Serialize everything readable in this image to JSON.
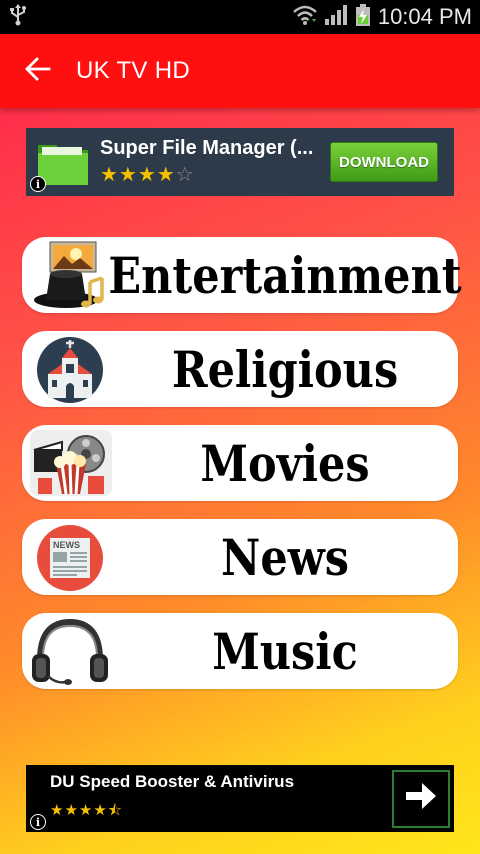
{
  "status_bar": {
    "time": "10:04 PM"
  },
  "app_bar": {
    "title": "UK TV HD"
  },
  "ad_top": {
    "title": "Super File Manager (...",
    "rating_stars": 4,
    "button_label": "DOWNLOAD",
    "info_glyph": "i"
  },
  "categories": [
    {
      "label": "Entertainment",
      "icon": "film-hat-icon"
    },
    {
      "label": "Religious",
      "icon": "church-icon"
    },
    {
      "label": "Movies",
      "icon": "popcorn-film-icon"
    },
    {
      "label": "News",
      "icon": "newspaper-icon"
    },
    {
      "label": "Music",
      "icon": "headphones-icon"
    }
  ],
  "ad_bottom": {
    "title": "DU Speed Booster & Antivirus",
    "rating_stars": 4.5,
    "info_glyph": "i"
  },
  "colors": {
    "app_bar": "#ff0f10",
    "gradient_top": "#ff1f4b",
    "gradient_bottom": "#ffe61a",
    "download_green": "#4fae21",
    "star_gold": "#f5c000"
  }
}
